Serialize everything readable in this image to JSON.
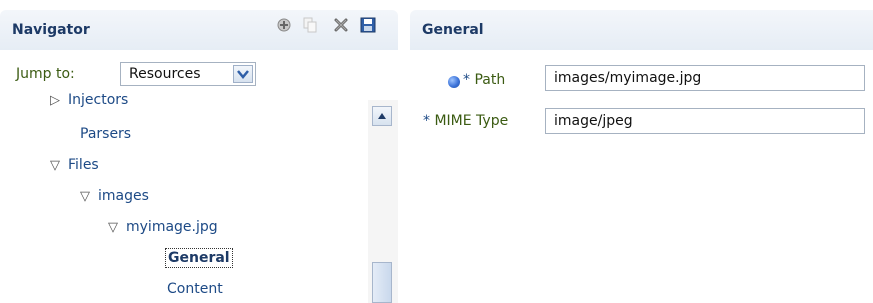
{
  "navigator": {
    "title": "Navigator",
    "toolbar": {
      "add_icon": "add-icon",
      "copy_icon": "copy-icon",
      "delete_icon": "delete-icon",
      "save_icon": "save-icon"
    },
    "jump_to": {
      "label": "Jump to:",
      "selected": "Resources"
    },
    "tree": [
      {
        "label": "Injectors"
      },
      {
        "label": "Parsers"
      },
      {
        "label": "Files"
      },
      {
        "label": "images"
      },
      {
        "label": "myimage.jpg"
      },
      {
        "label": "General"
      },
      {
        "label": "Content"
      }
    ]
  },
  "general": {
    "title": "General",
    "path": {
      "required": "*",
      "label": "Path",
      "value": "images/myimage.jpg"
    },
    "mime": {
      "required": "*",
      "label": "MIME Type",
      "value": "image/jpeg"
    }
  },
  "colors": {
    "header_bg": "#e6edf5",
    "tree_text": "#1d4a86",
    "label_text": "#3b5b12"
  }
}
